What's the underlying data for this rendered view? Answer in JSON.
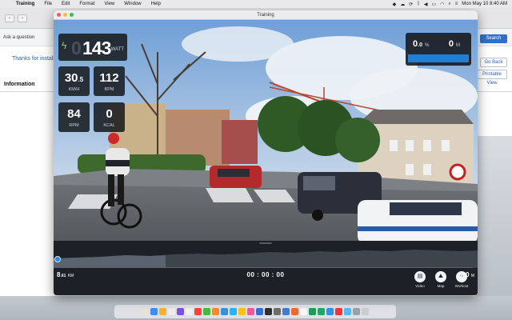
{
  "menubar": {
    "app_name": "Training",
    "menu_items": [
      "File",
      "Edit",
      "Format",
      "View",
      "Window",
      "Help"
    ],
    "clock": "Mon May 10  8:40 AM"
  },
  "background_window": {
    "ask_question": "Ask a question",
    "thanks_text": "Thanks for install",
    "information_heading": "Information",
    "search_button": "Search",
    "go_back_button": "Go Back",
    "printable_view_button": "Printable View"
  },
  "window": {
    "title": "Training"
  },
  "metrics": {
    "power_ghost": "0",
    "power_value": "143",
    "power_unit": "WATT",
    "speed_int": "30",
    "speed_dec": ".5",
    "speed_unit": "KM/H",
    "heart_rate": "112",
    "heart_rate_unit": "BPM",
    "cadence": "84",
    "cadence_unit": "RPM",
    "calories": "0",
    "calories_unit": "KCAL"
  },
  "grade": {
    "value_int": "0",
    "value_dec": ".0",
    "unit": "%",
    "distance": "0",
    "distance_unit": "M"
  },
  "route": {
    "distance_int": "8",
    "distance_dec": ".61",
    "distance_unit": "KM",
    "elapsed": "00 : 00 : 00",
    "remaining": "0",
    "remaining_unit": "M",
    "progress_fraction": 0.0
  },
  "modes": {
    "video_label": "Video",
    "map_label": "Map",
    "workout_label": "Workout"
  },
  "colors": {
    "accent": "#2b88e6",
    "power_bolt": "#8fd14f",
    "panel_bg": "#1d2127"
  }
}
